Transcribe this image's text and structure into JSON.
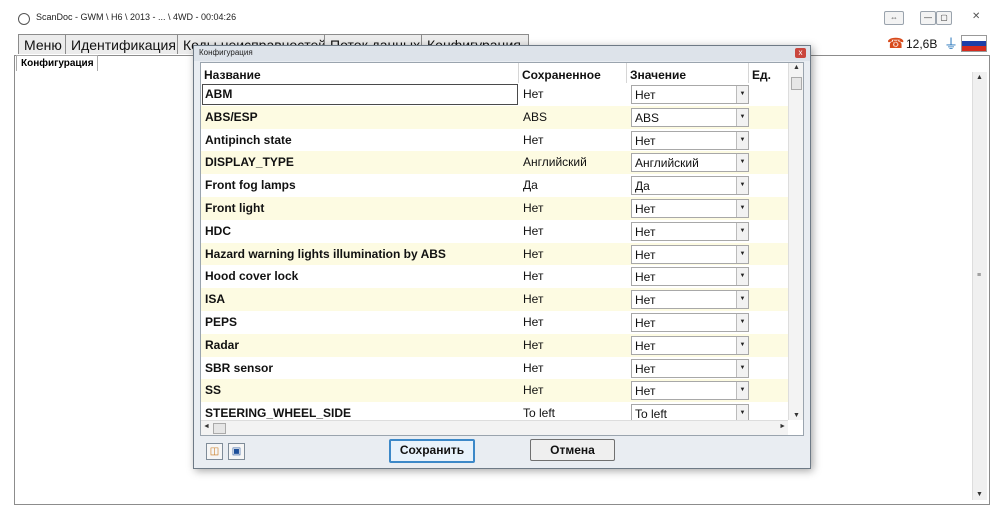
{
  "window": {
    "title": "ScanDoc - GWM \\ H6 \\ 2013 - ... \\ 4WD - 00:04:26",
    "controls": [
      "⇔",
      "—",
      "▢",
      "✕"
    ]
  },
  "menu": {
    "tabs": [
      "Меню",
      "Идентификация",
      "Коды неисправностей",
      "Поток данных",
      "Конфигурация"
    ],
    "voltage": "12,6В",
    "flag_colors": [
      "#ffffff",
      "#1c3fa8",
      "#d52b1e"
    ]
  },
  "main": {
    "sub_tab": "Конфигурация"
  },
  "dialog": {
    "title": "Конфигурация",
    "close_label": "x",
    "columns": {
      "name": "Название",
      "saved": "Сохраненное",
      "value": "Значение",
      "unit": "Ед."
    },
    "rows": [
      {
        "name": "ABM",
        "saved": "Нет",
        "value": "Нет",
        "unit": ""
      },
      {
        "name": "ABS/ESP",
        "saved": "ABS",
        "value": "ABS",
        "unit": ""
      },
      {
        "name": "Antipinch state",
        "saved": "Нет",
        "value": "Нет",
        "unit": ""
      },
      {
        "name": "DISPLAY_TYPE",
        "saved": "Английский",
        "value": "Английский",
        "unit": ""
      },
      {
        "name": "Front fog lamps",
        "saved": "Да",
        "value": "Да",
        "unit": ""
      },
      {
        "name": "Front light",
        "saved": "Нет",
        "value": "Нет",
        "unit": ""
      },
      {
        "name": "HDC",
        "saved": "Нет",
        "value": "Нет",
        "unit": ""
      },
      {
        "name": "Hazard warning lights illumination by ABS",
        "saved": "Нет",
        "value": "Нет",
        "unit": ""
      },
      {
        "name": "Hood cover lock",
        "saved": "Нет",
        "value": "Нет",
        "unit": ""
      },
      {
        "name": "ISA",
        "saved": "Нет",
        "value": "Нет",
        "unit": ""
      },
      {
        "name": "PEPS",
        "saved": "Нет",
        "value": "Нет",
        "unit": ""
      },
      {
        "name": "Radar",
        "saved": "Нет",
        "value": "Нет",
        "unit": ""
      },
      {
        "name": "SBR sensor",
        "saved": "Нет",
        "value": "Нет",
        "unit": ""
      },
      {
        "name": "SS",
        "saved": "Нет",
        "value": "Нет",
        "unit": ""
      },
      {
        "name": "STEERING_WHEEL_SIDE",
        "saved": "To left",
        "value": "To left",
        "unit": ""
      }
    ],
    "save_label": "Сохранить",
    "cancel_label": "Отмена",
    "icons": [
      "open-folder-icon",
      "save-disk-icon"
    ]
  }
}
